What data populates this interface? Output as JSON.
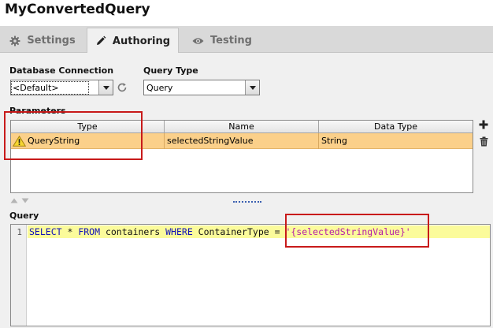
{
  "window": {
    "title": "MyConvertedQuery"
  },
  "tabs": [
    {
      "label": "Settings",
      "icon": "gear-icon",
      "active": false
    },
    {
      "label": "Authoring",
      "icon": "pencil-icon",
      "active": true
    },
    {
      "label": "Testing",
      "icon": "eye-icon",
      "active": false
    }
  ],
  "connection": {
    "label": "Database Connection",
    "value": "<Default>"
  },
  "query_type": {
    "label": "Query Type",
    "value": "Query"
  },
  "parameters": {
    "label": "Parameters",
    "columns": [
      "Type",
      "Name",
      "Data Type"
    ],
    "rows": [
      {
        "type": "QueryString",
        "name": "selectedStringValue",
        "data_type": "String"
      }
    ]
  },
  "query": {
    "label": "Query",
    "line_number": "1",
    "tokens": {
      "select": "SELECT",
      "star": " * ",
      "from": "FROM",
      "table": " containers ",
      "where": "WHERE",
      "cond": " ContainerType = ",
      "literal": "'{selectedStringValue}'"
    }
  },
  "colors": {
    "highlight_row": "#fbd08a",
    "annotation_box": "#c81a1a",
    "current_line": "#fbfb9b"
  }
}
